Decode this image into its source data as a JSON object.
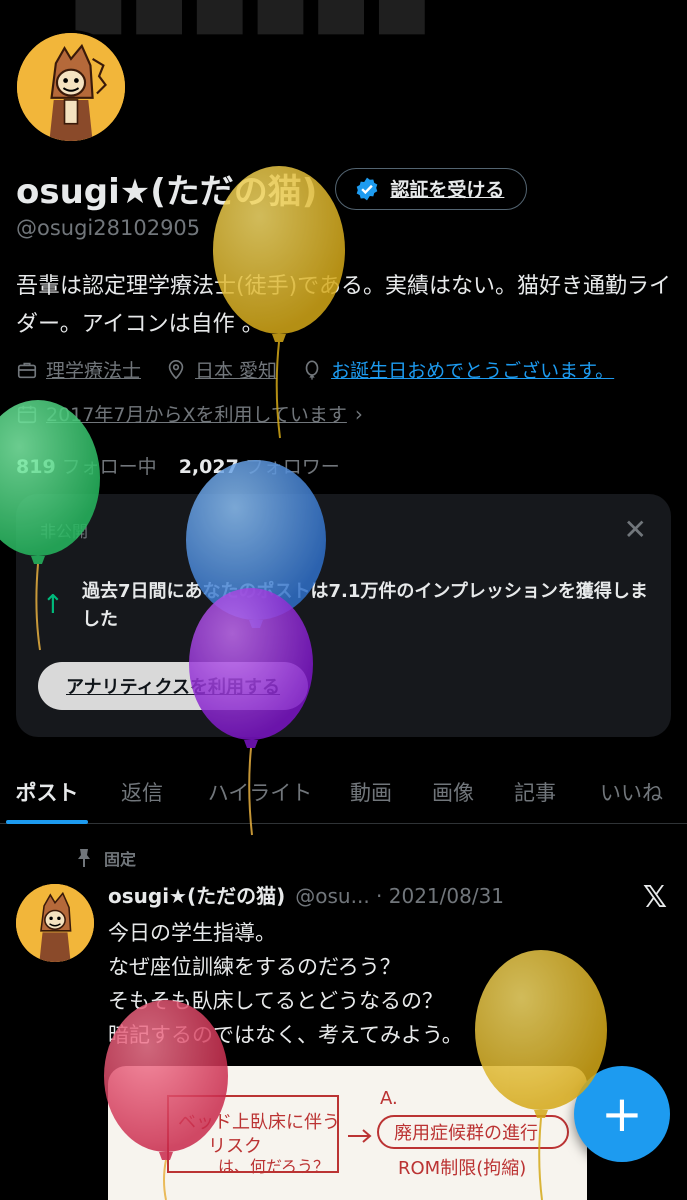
{
  "profile": {
    "display_name": "osugi★(ただの猫)",
    "handle": "@osugi28102905",
    "verify_label": "認証を受ける",
    "bio": "吾輩は認定理学療法士(徒手)である。実績はない。猫好き通勤ライダー。アイコンは自作 。",
    "job": "理学療法士",
    "location": "日本 愛知",
    "birthday": "お誕生日おめでとうございます。",
    "joined": "2017年7月からXを利用しています",
    "following_count": "819",
    "following_label": "フォロー中",
    "followers_count": "2,027",
    "followers_label": "フォロワー"
  },
  "private_card": {
    "label": "非公開",
    "message": "過去7日間にあなたのポストは7.1万件のインプレッションを獲得しました",
    "button_label": "アナリティクスを利用する"
  },
  "tabs": [
    {
      "label": "ポスト",
      "active": true
    },
    {
      "label": "返信",
      "active": false
    },
    {
      "label": "ハイライト",
      "active": false
    },
    {
      "label": "動画",
      "active": false
    },
    {
      "label": "画像",
      "active": false
    },
    {
      "label": "記事",
      "active": false
    },
    {
      "label": "いいね",
      "active": false
    }
  ],
  "post": {
    "pinned_label": "固定",
    "author": "osugi★(ただの猫)",
    "handle_date": "@osu... · 2021/08/31",
    "text": "今日の学生指導。\nなぜ座位訓練をするのだろう？\nそもそも臥床してるとどうなるの？\n暗記するのではなく、考えてみよう。",
    "image_lines": [
      "ベッド上臥床に伴う",
      "リスク",
      "は、何だろう？",
      "A.",
      "廃用症候群の進行",
      "ROM制限(拘縮)"
    ]
  },
  "fab_label": "+",
  "colors": {
    "accent": "#1d9bf0",
    "up_arrow": "#00ba7c",
    "balloon_yellow": "#e8c23a",
    "balloon_green": "#3ed67a",
    "balloon_blue": "#4a90e2",
    "balloon_purple": "#9b30e0",
    "balloon_red": "#e84a6a"
  }
}
